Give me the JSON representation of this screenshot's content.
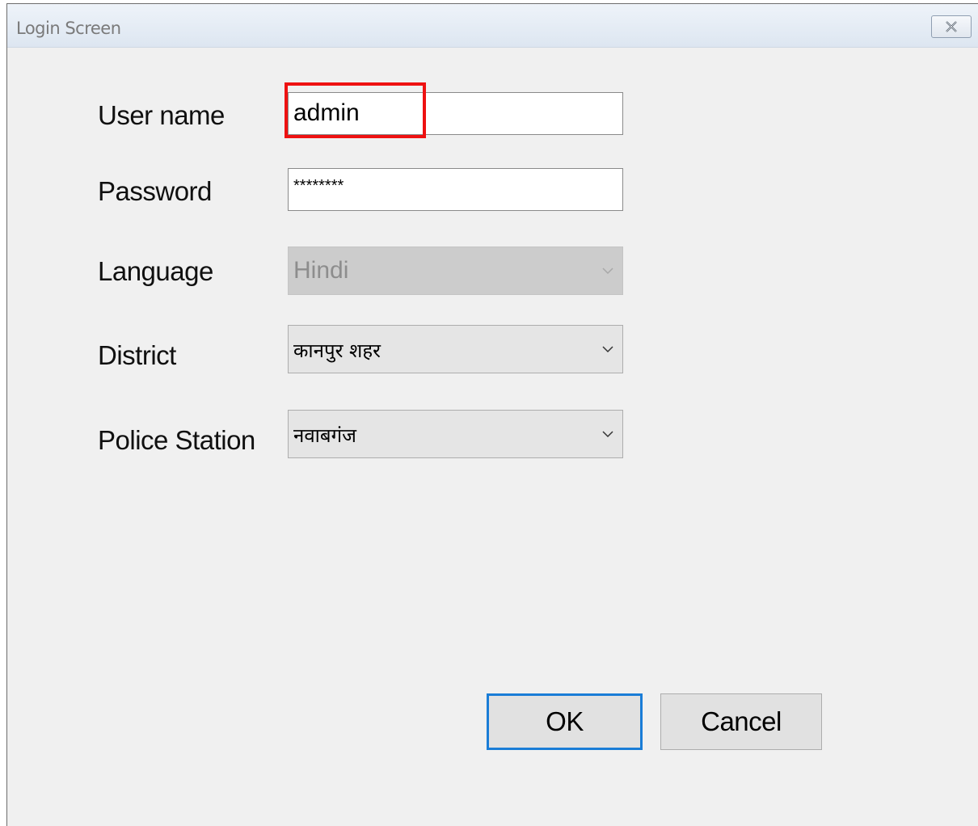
{
  "window": {
    "title": "Login Screen"
  },
  "form": {
    "username": {
      "label": "User name",
      "value": "admin"
    },
    "password": {
      "label": "Password",
      "value": "********"
    },
    "language": {
      "label": "Language",
      "value": "Hindi",
      "disabled": true
    },
    "district": {
      "label": "District",
      "value": "कानपुर शहर"
    },
    "police_station": {
      "label": "Police Station",
      "value": "नवाबगंज"
    }
  },
  "buttons": {
    "ok_label": "OK",
    "cancel_label": "Cancel"
  },
  "icons": {
    "close": "close-icon",
    "dropdown": "chevron-down-icon"
  },
  "colors": {
    "highlight": "#ee1111",
    "default_button_border": "#1a7dd7"
  }
}
